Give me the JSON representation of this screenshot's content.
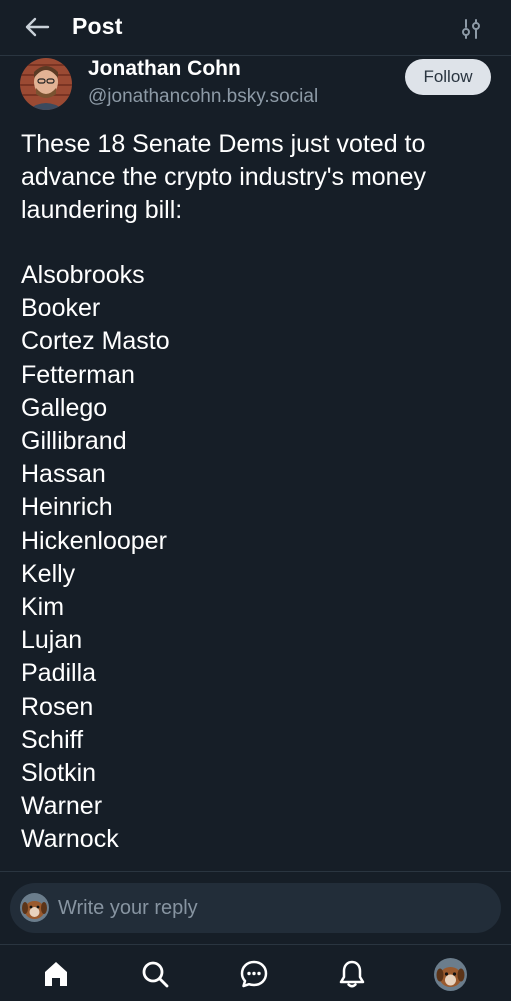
{
  "header": {
    "title": "Post",
    "back_icon": "arrow-left-icon",
    "filter_icon": "sliders-icon"
  },
  "post": {
    "author_name": "Jonathan Cohn",
    "author_handle": "@jonathancohn.bsky.social",
    "follow_label": "Follow",
    "intro": "These 18 Senate Dems just voted to advance the crypto industry's money laundering bill:",
    "names": [
      "Alsobrooks",
      "Booker",
      "Cortez Masto",
      "Fetterman",
      "Gallego",
      "Gillibrand",
      "Hassan",
      "Heinrich",
      "Hickenlooper",
      "Kelly",
      "Kim",
      "Lujan",
      "Padilla",
      "Rosen",
      "Schiff",
      "Slotkin",
      "Warner",
      "Warnock"
    ]
  },
  "reply": {
    "placeholder": "Write your reply"
  },
  "nav": {
    "items": [
      "home-icon",
      "search-icon",
      "chat-icon",
      "bell-icon",
      "profile-avatar"
    ]
  },
  "colors": {
    "background": "#161e27",
    "text": "#ffffff",
    "muted": "#8d9aa6",
    "follow_bg": "#dee3e9",
    "reply_bg": "#222d39"
  }
}
